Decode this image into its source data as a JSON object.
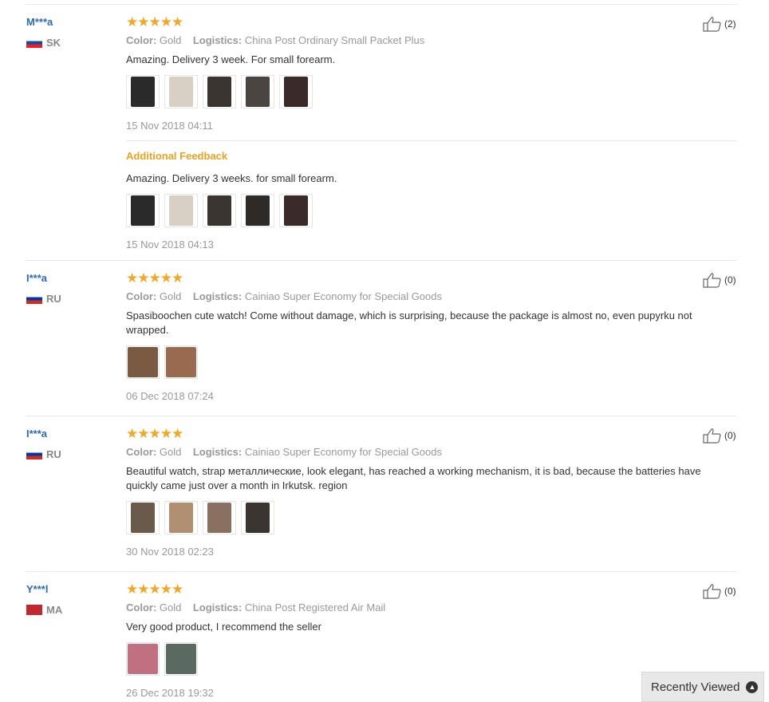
{
  "reviews": [
    {
      "user": "M***a",
      "country": "SK",
      "flag_colors": [
        "#ffffff",
        "#0b4ea2",
        "#ee1c25"
      ],
      "stars": "★★★★★",
      "color_label": "Color:",
      "color_value": "Gold",
      "logistics_label": "Logistics:",
      "logistics_value": "China Post Ordinary Small Packet Plus",
      "text": "Amazing. Delivery 3 week. For small forearm.",
      "images": [
        "#2a2a2a",
        "#d8d0c4",
        "#3a3530",
        "#4a4540",
        "#3a2a2a"
      ],
      "date": "15 Nov 2018 04:11",
      "likes": "(2)",
      "additional": {
        "title": "Additional Feedback",
        "text": "Amazing. Delivery 3 weeks. for small forearm.",
        "images": [
          "#2a2a2a",
          "#d8d0c4",
          "#3a3530",
          "#2e2a28",
          "#3a2a2a"
        ],
        "date": "15 Nov 2018 04:13"
      }
    },
    {
      "user": "I***a",
      "country": "RU",
      "flag_colors": [
        "#ffffff",
        "#0039a6",
        "#d52b1e"
      ],
      "stars": "★★★★★",
      "color_label": "Color:",
      "color_value": "Gold",
      "logistics_label": "Logistics:",
      "logistics_value": "Cainiao Super Economy for Special Goods",
      "text": "Spasiboochen cute watch! Come without damage, which is surprising, because the package is almost no, even pupyrku not wrapped.",
      "images": [
        "#7a5a40",
        "#9a6a50"
      ],
      "date": "06 Dec 2018 07:24",
      "likes": "(0)"
    },
    {
      "user": "I***a",
      "country": "RU",
      "flag_colors": [
        "#ffffff",
        "#0039a6",
        "#d52b1e"
      ],
      "stars": "★★★★★",
      "color_label": "Color:",
      "color_value": "Gold",
      "logistics_label": "Logistics:",
      "logistics_value": "Cainiao Super Economy for Special Goods",
      "text": "Beautiful watch, strap металлические, look elegant, has reached a working mechanism, it is bad, because the batteries have quickly came just over a month in Irkutsk. region",
      "images": [
        "#6a5a4a",
        "#b09070",
        "#8a7060",
        "#3a3530"
      ],
      "date": "30 Nov 2018 02:23",
      "likes": "(0)"
    },
    {
      "user": "Y***l",
      "country": "MA",
      "flag_colors": [
        "#c1272d",
        "#c1272d",
        "#c1272d"
      ],
      "stars": "★★★★★",
      "color_label": "Color:",
      "color_value": "Gold",
      "logistics_label": "Logistics:",
      "logistics_value": "China Post Registered Air Mail",
      "text": "Very good product, I recommend the seller",
      "images": [
        "#c07080",
        "#5a6a60"
      ],
      "date": "26 Dec 2018 19:32",
      "likes": "(0)"
    }
  ],
  "recently_viewed": "Recently Viewed"
}
